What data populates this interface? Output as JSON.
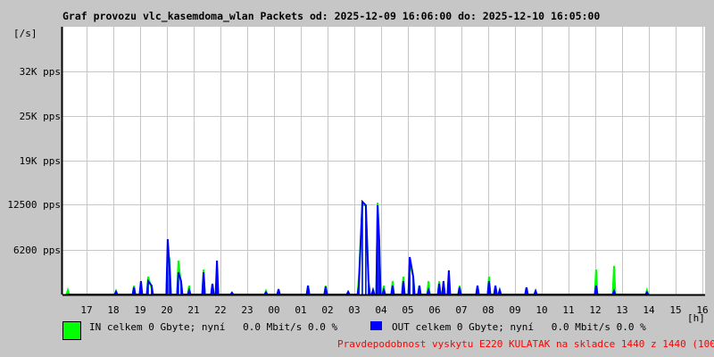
{
  "chart_data": {
    "type": "line",
    "title": "Graf provozu vlc_kasemdoma_wlan Packets od: 2025-12-09 16:06:00 do: 2025-12-10 16:05:00",
    "ylabel": "[/s]",
    "xlabel": "[h]",
    "xlim_hours_from_start": [
      0,
      24
    ],
    "ylim": [
      0,
      37200
    ],
    "grid": true,
    "y_ticks": [
      {
        "value": 6200,
        "label": "6200 pps"
      },
      {
        "value": 12500,
        "label": "12500 pps"
      },
      {
        "value": 18600,
        "label": "19K pps"
      },
      {
        "value": 24800,
        "label": "25K pps"
      },
      {
        "value": 31000,
        "label": "32K pps"
      }
    ],
    "x_ticks": [
      {
        "value": 0.9,
        "label": "17"
      },
      {
        "value": 1.9,
        "label": "18"
      },
      {
        "value": 2.9,
        "label": "19"
      },
      {
        "value": 3.9,
        "label": "20"
      },
      {
        "value": 4.9,
        "label": "21"
      },
      {
        "value": 5.9,
        "label": "22"
      },
      {
        "value": 6.9,
        "label": "23"
      },
      {
        "value": 7.9,
        "label": "00"
      },
      {
        "value": 8.9,
        "label": "01"
      },
      {
        "value": 9.9,
        "label": "02"
      },
      {
        "value": 10.9,
        "label": "03"
      },
      {
        "value": 11.9,
        "label": "04"
      },
      {
        "value": 12.9,
        "label": "05"
      },
      {
        "value": 13.9,
        "label": "06"
      },
      {
        "value": 14.9,
        "label": "07"
      },
      {
        "value": 15.9,
        "label": "08"
      },
      {
        "value": 16.9,
        "label": "09"
      },
      {
        "value": 17.9,
        "label": "10"
      },
      {
        "value": 18.9,
        "label": "11"
      },
      {
        "value": 19.9,
        "label": "12"
      },
      {
        "value": 20.9,
        "label": "13"
      },
      {
        "value": 21.9,
        "label": "14"
      },
      {
        "value": 22.9,
        "label": "15"
      },
      {
        "value": 23.9,
        "label": "16"
      }
    ],
    "series_columns": [
      "hours_from_start",
      "in_pps",
      "out_pps"
    ],
    "points": [
      [
        0.2,
        620,
        0
      ],
      [
        2.0,
        500,
        400
      ],
      [
        2.67,
        1240,
        990
      ],
      [
        2.93,
        1490,
        1860
      ],
      [
        3.2,
        2480,
        1860
      ],
      [
        3.33,
        800,
        1240
      ],
      [
        3.93,
        5580,
        7690
      ],
      [
        4.0,
        4960,
        3720
      ],
      [
        4.33,
        4710,
        3100
      ],
      [
        4.43,
        1240,
        1860
      ],
      [
        4.73,
        1240,
        600
      ],
      [
        5.27,
        3470,
        3100
      ],
      [
        5.6,
        1490,
        1490
      ],
      [
        5.77,
        2480,
        4710
      ],
      [
        6.33,
        250,
        250
      ],
      [
        7.6,
        500,
        300
      ],
      [
        8.07,
        300,
        740
      ],
      [
        9.17,
        1240,
        1240
      ],
      [
        9.83,
        1240,
        1100
      ],
      [
        10.67,
        370,
        370
      ],
      [
        11.07,
        2480,
        1240
      ],
      [
        11.2,
        12400,
        12900
      ],
      [
        11.33,
        12400,
        12400
      ],
      [
        11.43,
        1860,
        1860
      ],
      [
        11.6,
        620,
        620
      ],
      [
        11.77,
        12770,
        12400
      ],
      [
        11.83,
        7440,
        7440
      ],
      [
        12.0,
        1240,
        620
      ],
      [
        12.33,
        1860,
        1240
      ],
      [
        12.73,
        2480,
        1860
      ],
      [
        12.97,
        4340,
        5200
      ],
      [
        13.1,
        2480,
        2480
      ],
      [
        13.33,
        1240,
        1240
      ],
      [
        13.67,
        1860,
        620
      ],
      [
        14.07,
        1860,
        1500
      ],
      [
        14.23,
        1490,
        1860
      ],
      [
        14.43,
        1240,
        3350
      ],
      [
        14.83,
        1240,
        1000
      ],
      [
        15.5,
        1240,
        1240
      ],
      [
        15.93,
        2480,
        1860
      ],
      [
        16.17,
        1240,
        1240
      ],
      [
        16.33,
        620,
        620
      ],
      [
        17.33,
        990,
        990
      ],
      [
        17.67,
        500,
        500
      ],
      [
        19.93,
        3470,
        1240
      ],
      [
        20.6,
        3970,
        500
      ],
      [
        21.83,
        620,
        300
      ]
    ],
    "series": [
      {
        "name": "IN",
        "color": "#00ff00"
      },
      {
        "name": "OUT",
        "color": "#0000ff"
      }
    ]
  },
  "legend": {
    "in_text": "IN celkem 0 Gbyte; nyní   0.0 Mbit/s 0.0 %",
    "out_text": "OUT celkem 0 Gbyte; nyní   0.0 Mbit/s 0.0 %"
  },
  "note": "Pravdepodobnost vyskytu E220 KULATAK na skladce 1440 z 1440 (100.0 %)"
}
